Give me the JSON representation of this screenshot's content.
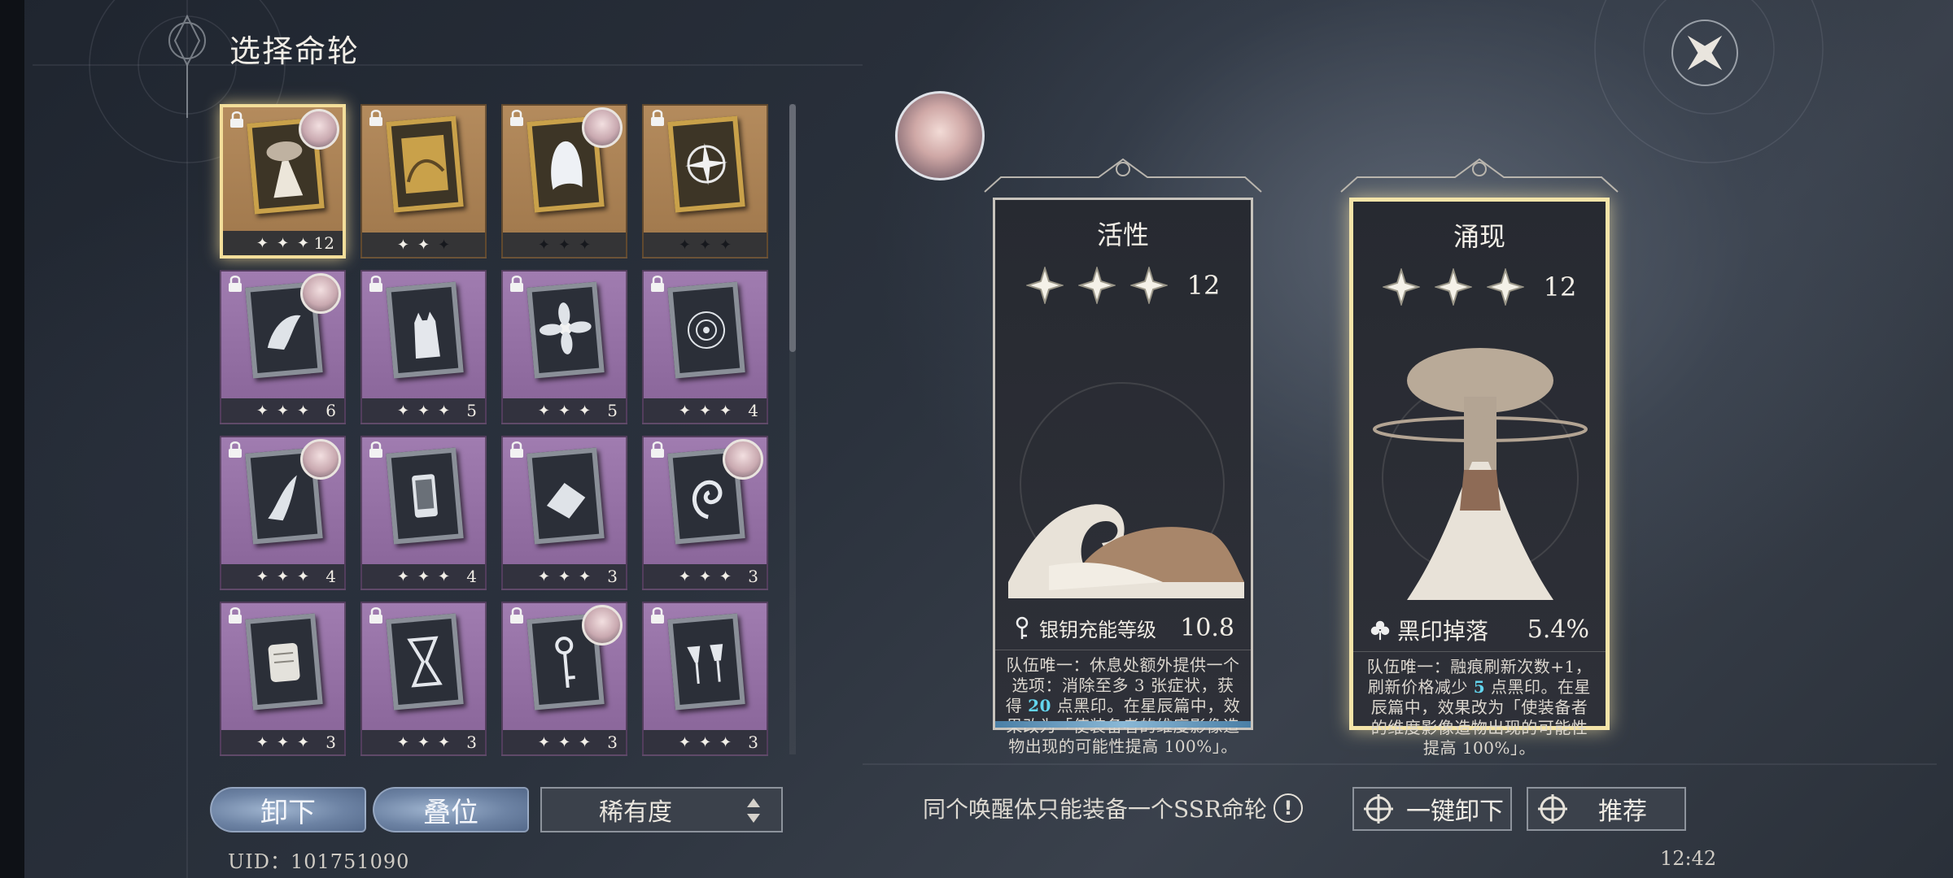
{
  "header": {
    "title": "选择命轮"
  },
  "cards": [
    {
      "rarity": "gold",
      "selected": true,
      "locked": true,
      "badge": true,
      "stars": [
        1,
        1,
        1
      ],
      "level": "12",
      "art": "volcano-icon"
    },
    {
      "rarity": "gold",
      "selected": false,
      "locked": true,
      "badge": false,
      "stars": [
        1,
        1,
        0
      ],
      "level": "",
      "art": "gold-painting-icon"
    },
    {
      "rarity": "gold",
      "selected": false,
      "locked": true,
      "badge": true,
      "stars": [
        0,
        0,
        0
      ],
      "level": "",
      "art": "ghost-icon"
    },
    {
      "rarity": "gold",
      "selected": false,
      "locked": true,
      "badge": false,
      "stars": [
        0,
        0,
        0
      ],
      "level": "",
      "art": "compass-wheel-icon"
    },
    {
      "rarity": "purple",
      "selected": false,
      "locked": true,
      "badge": true,
      "stars": [
        1,
        1,
        1
      ],
      "level": "6",
      "art": "bird-icon"
    },
    {
      "rarity": "purple",
      "selected": false,
      "locked": true,
      "badge": false,
      "stars": [
        1,
        1,
        1
      ],
      "level": "5",
      "art": "cat-icon"
    },
    {
      "rarity": "purple",
      "selected": false,
      "locked": true,
      "badge": false,
      "stars": [
        1,
        1,
        1
      ],
      "level": "5",
      "art": "flower-icon"
    },
    {
      "rarity": "purple",
      "selected": false,
      "locked": true,
      "badge": false,
      "stars": [
        1,
        1,
        1
      ],
      "level": "4",
      "art": "spiral-icon"
    },
    {
      "rarity": "purple",
      "selected": false,
      "locked": true,
      "badge": true,
      "stars": [
        1,
        1,
        1
      ],
      "level": "4",
      "art": "hand-icon"
    },
    {
      "rarity": "purple",
      "selected": false,
      "locked": true,
      "badge": false,
      "stars": [
        1,
        1,
        1
      ],
      "level": "4",
      "art": "phone-icon"
    },
    {
      "rarity": "purple",
      "selected": false,
      "locked": true,
      "badge": false,
      "stars": [
        1,
        1,
        1
      ],
      "level": "3",
      "art": "shard-icon"
    },
    {
      "rarity": "purple",
      "selected": false,
      "locked": true,
      "badge": true,
      "stars": [
        1,
        1,
        1
      ],
      "level": "3",
      "art": "swirl-icon"
    },
    {
      "rarity": "purple",
      "selected": false,
      "locked": true,
      "badge": false,
      "stars": [
        1,
        1,
        1
      ],
      "level": "3",
      "art": "scroll-icon"
    },
    {
      "rarity": "purple",
      "selected": false,
      "locked": true,
      "badge": false,
      "stars": [
        1,
        1,
        1
      ],
      "level": "3",
      "art": "hourglass-icon"
    },
    {
      "rarity": "purple",
      "selected": false,
      "locked": true,
      "badge": true,
      "stars": [
        1,
        1,
        1
      ],
      "level": "3",
      "art": "key-icon"
    },
    {
      "rarity": "purple",
      "selected": false,
      "locked": true,
      "badge": false,
      "stars": [
        1,
        1,
        1
      ],
      "level": "3",
      "art": "goblet-icon"
    }
  ],
  "buttons": {
    "unequip": "卸下",
    "stack": "叠位",
    "sort": "稀有度",
    "unequip_all": "一键卸下",
    "recommend": "推荐"
  },
  "uid": "UID：101751090",
  "notice": "同个唤醒体只能装备一个SSR命轮",
  "info_icon": "!",
  "detail_left": {
    "name": "活性",
    "level": "12",
    "stat_label": "银钥充能等级",
    "stat_value": "10.8",
    "desc_parts": [
      "队伍唯一：休息处额外提供一个选项：消除至多 3 张症状，获得 ",
      "20",
      " 点黑印。在星辰篇中，效果改为「使装备者的维度影像造物出现的可能性提高 100%」。"
    ]
  },
  "detail_right": {
    "name": "涌现",
    "level": "12",
    "stat_label": "黑印掉落",
    "stat_value": "5.4%",
    "desc_parts": [
      "队伍唯一：融痕刷新次数+1，刷新价格减少 ",
      "5",
      " 点黑印。在星辰篇中，效果改为「使装备者的维度影像造物出现的可能性提高 100%」。"
    ]
  },
  "clock": "12:42",
  "colors": {
    "gold_card": "#b48b5d",
    "purple_card": "#a07cb0",
    "highlight": "#63d5ee",
    "selected_border": "#f3de9a"
  }
}
